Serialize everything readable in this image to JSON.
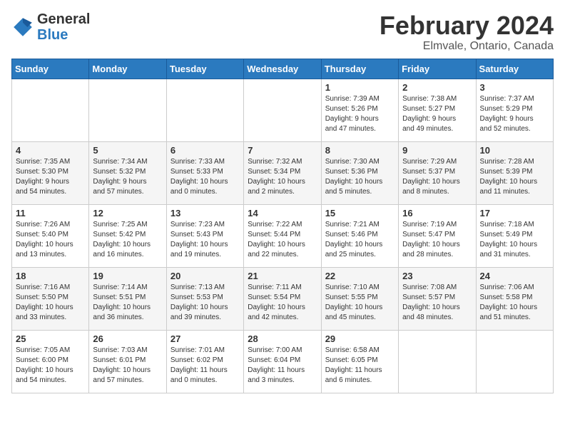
{
  "logo": {
    "text_general": "General",
    "text_blue": "Blue"
  },
  "title": "February 2024",
  "subtitle": "Elmvale, Ontario, Canada",
  "header_days": [
    "Sunday",
    "Monday",
    "Tuesday",
    "Wednesday",
    "Thursday",
    "Friday",
    "Saturday"
  ],
  "weeks": [
    [
      {
        "day": "",
        "info": ""
      },
      {
        "day": "",
        "info": ""
      },
      {
        "day": "",
        "info": ""
      },
      {
        "day": "",
        "info": ""
      },
      {
        "day": "1",
        "info": "Sunrise: 7:39 AM\nSunset: 5:26 PM\nDaylight: 9 hours\nand 47 minutes."
      },
      {
        "day": "2",
        "info": "Sunrise: 7:38 AM\nSunset: 5:27 PM\nDaylight: 9 hours\nand 49 minutes."
      },
      {
        "day": "3",
        "info": "Sunrise: 7:37 AM\nSunset: 5:29 PM\nDaylight: 9 hours\nand 52 minutes."
      }
    ],
    [
      {
        "day": "4",
        "info": "Sunrise: 7:35 AM\nSunset: 5:30 PM\nDaylight: 9 hours\nand 54 minutes."
      },
      {
        "day": "5",
        "info": "Sunrise: 7:34 AM\nSunset: 5:32 PM\nDaylight: 9 hours\nand 57 minutes."
      },
      {
        "day": "6",
        "info": "Sunrise: 7:33 AM\nSunset: 5:33 PM\nDaylight: 10 hours\nand 0 minutes."
      },
      {
        "day": "7",
        "info": "Sunrise: 7:32 AM\nSunset: 5:34 PM\nDaylight: 10 hours\nand 2 minutes."
      },
      {
        "day": "8",
        "info": "Sunrise: 7:30 AM\nSunset: 5:36 PM\nDaylight: 10 hours\nand 5 minutes."
      },
      {
        "day": "9",
        "info": "Sunrise: 7:29 AM\nSunset: 5:37 PM\nDaylight: 10 hours\nand 8 minutes."
      },
      {
        "day": "10",
        "info": "Sunrise: 7:28 AM\nSunset: 5:39 PM\nDaylight: 10 hours\nand 11 minutes."
      }
    ],
    [
      {
        "day": "11",
        "info": "Sunrise: 7:26 AM\nSunset: 5:40 PM\nDaylight: 10 hours\nand 13 minutes."
      },
      {
        "day": "12",
        "info": "Sunrise: 7:25 AM\nSunset: 5:42 PM\nDaylight: 10 hours\nand 16 minutes."
      },
      {
        "day": "13",
        "info": "Sunrise: 7:23 AM\nSunset: 5:43 PM\nDaylight: 10 hours\nand 19 minutes."
      },
      {
        "day": "14",
        "info": "Sunrise: 7:22 AM\nSunset: 5:44 PM\nDaylight: 10 hours\nand 22 minutes."
      },
      {
        "day": "15",
        "info": "Sunrise: 7:21 AM\nSunset: 5:46 PM\nDaylight: 10 hours\nand 25 minutes."
      },
      {
        "day": "16",
        "info": "Sunrise: 7:19 AM\nSunset: 5:47 PM\nDaylight: 10 hours\nand 28 minutes."
      },
      {
        "day": "17",
        "info": "Sunrise: 7:18 AM\nSunset: 5:49 PM\nDaylight: 10 hours\nand 31 minutes."
      }
    ],
    [
      {
        "day": "18",
        "info": "Sunrise: 7:16 AM\nSunset: 5:50 PM\nDaylight: 10 hours\nand 33 minutes."
      },
      {
        "day": "19",
        "info": "Sunrise: 7:14 AM\nSunset: 5:51 PM\nDaylight: 10 hours\nand 36 minutes."
      },
      {
        "day": "20",
        "info": "Sunrise: 7:13 AM\nSunset: 5:53 PM\nDaylight: 10 hours\nand 39 minutes."
      },
      {
        "day": "21",
        "info": "Sunrise: 7:11 AM\nSunset: 5:54 PM\nDaylight: 10 hours\nand 42 minutes."
      },
      {
        "day": "22",
        "info": "Sunrise: 7:10 AM\nSunset: 5:55 PM\nDaylight: 10 hours\nand 45 minutes."
      },
      {
        "day": "23",
        "info": "Sunrise: 7:08 AM\nSunset: 5:57 PM\nDaylight: 10 hours\nand 48 minutes."
      },
      {
        "day": "24",
        "info": "Sunrise: 7:06 AM\nSunset: 5:58 PM\nDaylight: 10 hours\nand 51 minutes."
      }
    ],
    [
      {
        "day": "25",
        "info": "Sunrise: 7:05 AM\nSunset: 6:00 PM\nDaylight: 10 hours\nand 54 minutes."
      },
      {
        "day": "26",
        "info": "Sunrise: 7:03 AM\nSunset: 6:01 PM\nDaylight: 10 hours\nand 57 minutes."
      },
      {
        "day": "27",
        "info": "Sunrise: 7:01 AM\nSunset: 6:02 PM\nDaylight: 11 hours\nand 0 minutes."
      },
      {
        "day": "28",
        "info": "Sunrise: 7:00 AM\nSunset: 6:04 PM\nDaylight: 11 hours\nand 3 minutes."
      },
      {
        "day": "29",
        "info": "Sunrise: 6:58 AM\nSunset: 6:05 PM\nDaylight: 11 hours\nand 6 minutes."
      },
      {
        "day": "",
        "info": ""
      },
      {
        "day": "",
        "info": ""
      }
    ]
  ]
}
